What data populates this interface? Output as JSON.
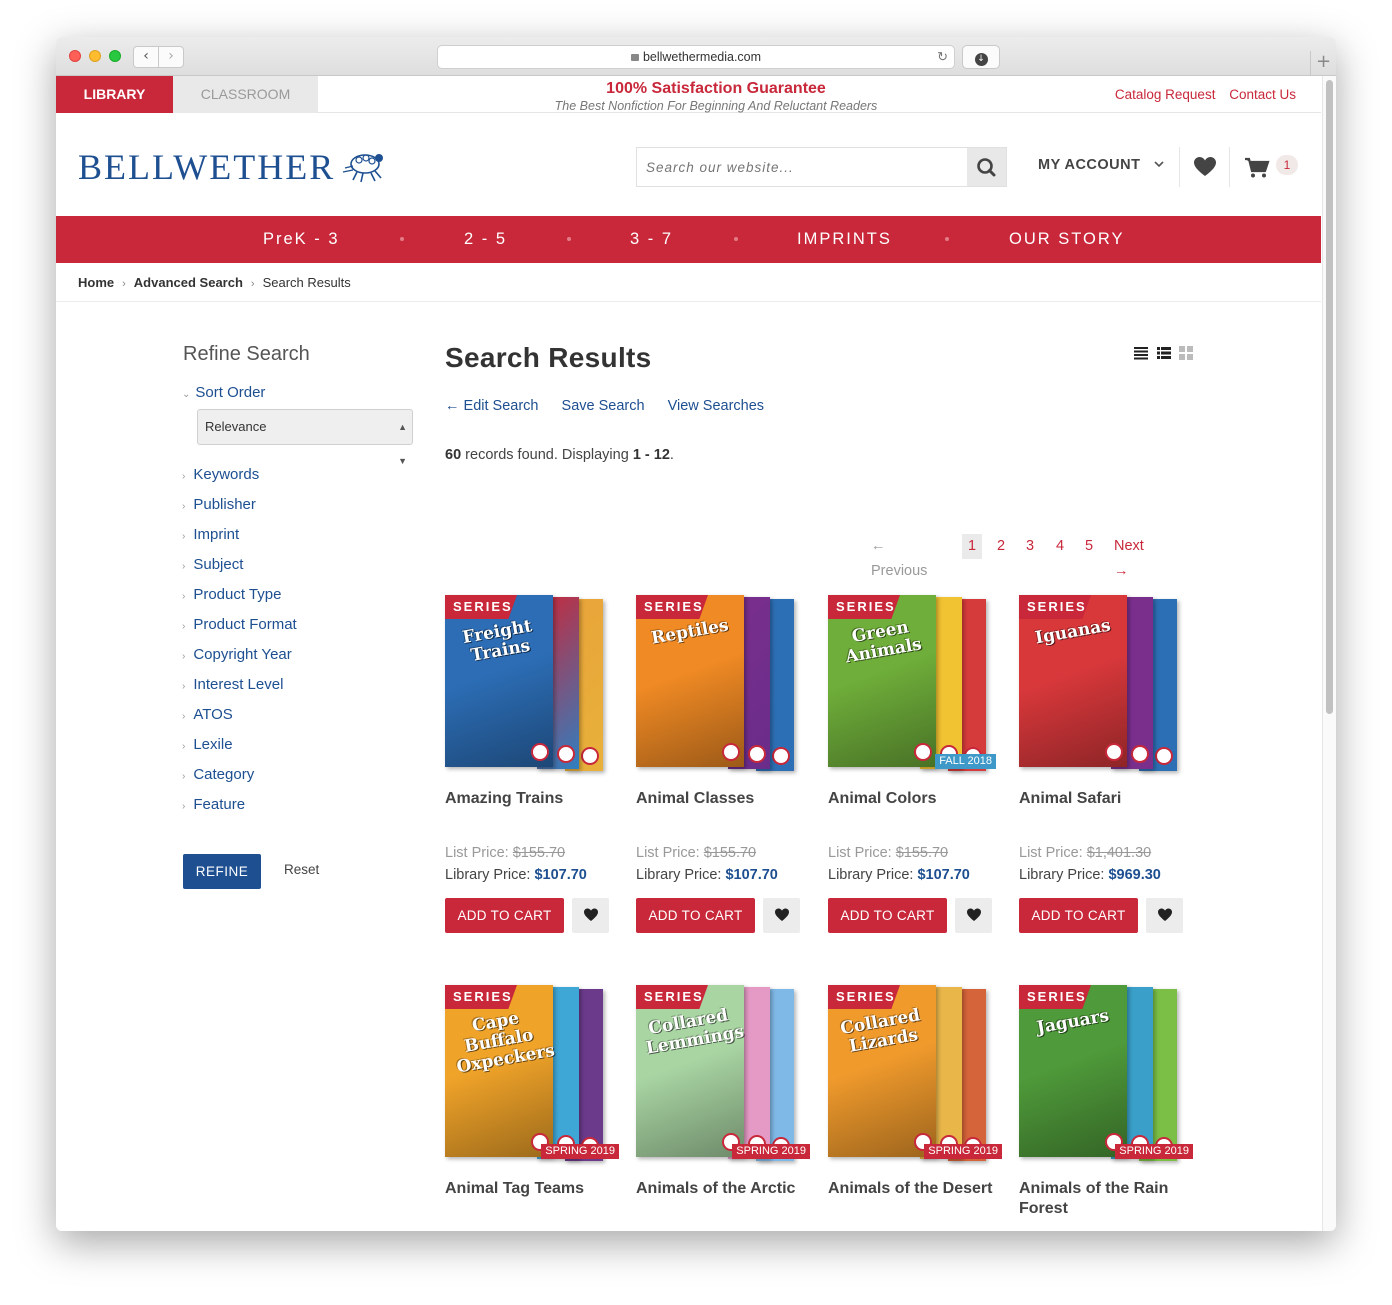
{
  "browser": {
    "url": "bellwethermedia.com"
  },
  "topbar": {
    "tab_library": "LIBRARY",
    "tab_classroom": "CLASSROOM",
    "guarantee_title": "100% Satisfaction Guarantee",
    "guarantee_subtitle": "The Best Nonfiction For Beginning And Reluctant Readers",
    "catalog_request": "Catalog Request",
    "contact_us": "Contact Us"
  },
  "header": {
    "logo_text": "BELLWETHER",
    "search_placeholder": "Search our website...",
    "my_account": "MY ACCOUNT",
    "cart_count": "1"
  },
  "main_nav": {
    "items": [
      "PreK - 3",
      "2 - 5",
      "3 - 7",
      "IMPRINTS",
      "OUR STORY"
    ]
  },
  "breadcrumb": {
    "home": "Home",
    "advanced_search": "Advanced Search",
    "current": "Search Results"
  },
  "sidebar": {
    "title": "Refine Search",
    "sort_order_label": "Sort Order",
    "sort_value": "Relevance",
    "facets": [
      "Keywords",
      "Publisher",
      "Imprint",
      "Subject",
      "Product Type",
      "Product Format",
      "Copyright Year",
      "Interest Level",
      "ATOS",
      "Lexile",
      "Category",
      "Feature"
    ],
    "refine_button": "REFINE",
    "reset_button": "Reset"
  },
  "results": {
    "title": "Search Results",
    "edit_search": "← Edit Search",
    "save_search": "Save Search",
    "view_searches": "View Searches",
    "total": "60",
    "records_mid": "records found. Displaying",
    "range": "1 - 12",
    "records_end": "."
  },
  "pagination": {
    "previous": "← Previous",
    "pages": [
      "1",
      "2",
      "3",
      "4",
      "5"
    ],
    "current": "1",
    "next": "Next →"
  },
  "labels": {
    "series_tag": "SERIES",
    "list_price": "List Price:",
    "library_price": "Library Price:",
    "add_to_cart": "ADD TO CART"
  },
  "products": [
    {
      "name": "Amazing Trains",
      "cover_title": "Freight Trains",
      "list_price": "$155.70",
      "library_price": "$107.70",
      "season": "",
      "colors": [
        "#2c6db5",
        "#c8283a",
        "#e9a43a"
      ],
      "spines": [
        "#2f7fc1",
        "#e8b13a"
      ]
    },
    {
      "name": "Animal Classes",
      "cover_title": "Reptiles",
      "list_price": "$155.70",
      "library_price": "$107.70",
      "season": "",
      "colors": [
        "#f08a24",
        "#7a2f8c",
        "#2d6fb5"
      ],
      "spines": [
        "#6a2c8a",
        "#2d6fb5"
      ]
    },
    {
      "name": "Animal Colors",
      "cover_title": "Green Animals",
      "list_price": "$155.70",
      "library_price": "$107.70",
      "season": "FALL 2018",
      "colors": [
        "#6fae3a",
        "#f1c232",
        "#d63b3b"
      ],
      "spines": [
        "#f1c232",
        "#d63b3b"
      ]
    },
    {
      "name": "Animal Safari",
      "cover_title": "Iguanas",
      "list_price": "$1,401.30",
      "library_price": "$969.30",
      "season": "",
      "colors": [
        "#d9383b",
        "#7a2f8c",
        "#2d6fb5"
      ],
      "spines": [
        "#7a2f8c",
        "#2d6fb5"
      ]
    },
    {
      "name": "Animal Tag Teams",
      "cover_title": "Cape Buffalo Oxpeckers",
      "list_price": "",
      "library_price": "",
      "season": "SPRING 2019",
      "colors": [
        "#f0a329",
        "#3fa7d6",
        "#6b3a8a"
      ],
      "spines": [
        "#3fa7d6",
        "#6b3a8a"
      ]
    },
    {
      "name": "Animals of the Arctic",
      "cover_title": "Collared Lemmings",
      "list_price": "",
      "library_price": "",
      "season": "SPRING 2019",
      "colors": [
        "#a9d5a3",
        "#e59ac6",
        "#7fb9e8"
      ],
      "spines": [
        "#e59ac6",
        "#7fb9e8"
      ]
    },
    {
      "name": "Animals of the Desert",
      "cover_title": "Collared Lizards",
      "list_price": "",
      "library_price": "",
      "season": "SPRING 2019",
      "colors": [
        "#f09a2c",
        "#e9b64a",
        "#d6643a"
      ],
      "spines": [
        "#e9b64a",
        "#d6643a"
      ]
    },
    {
      "name": "Animals of the Rain Forest",
      "cover_title": "Jaguars",
      "list_price": "",
      "library_price": "",
      "season": "SPRING 2019",
      "colors": [
        "#4f9a3a",
        "#3aa0c9",
        "#7bbf46"
      ],
      "spines": [
        "#3aa0c9",
        "#7bbf46"
      ]
    }
  ]
}
